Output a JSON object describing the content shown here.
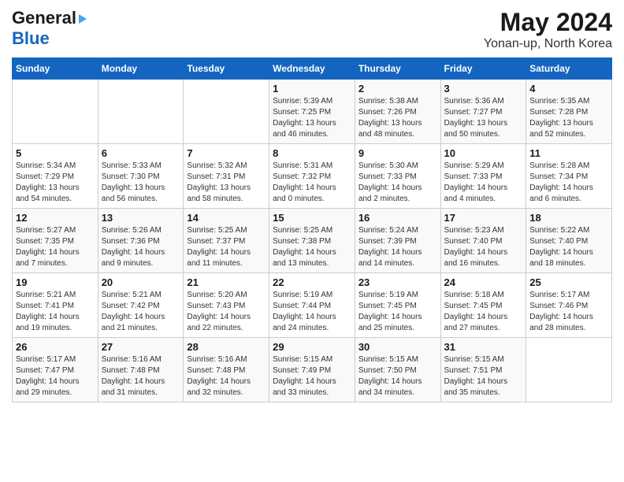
{
  "logo": {
    "line1": "General",
    "line2": "Blue"
  },
  "title": "May 2024",
  "subtitle": "Yonan-up, North Korea",
  "days_of_week": [
    "Sunday",
    "Monday",
    "Tuesday",
    "Wednesday",
    "Thursday",
    "Friday",
    "Saturday"
  ],
  "weeks": [
    [
      {
        "day": "",
        "info": ""
      },
      {
        "day": "",
        "info": ""
      },
      {
        "day": "",
        "info": ""
      },
      {
        "day": "1",
        "sunrise": "5:39 AM",
        "sunset": "7:25 PM",
        "daylight": "13 hours and 46 minutes."
      },
      {
        "day": "2",
        "sunrise": "5:38 AM",
        "sunset": "7:26 PM",
        "daylight": "13 hours and 48 minutes."
      },
      {
        "day": "3",
        "sunrise": "5:36 AM",
        "sunset": "7:27 PM",
        "daylight": "13 hours and 50 minutes."
      },
      {
        "day": "4",
        "sunrise": "5:35 AM",
        "sunset": "7:28 PM",
        "daylight": "13 hours and 52 minutes."
      }
    ],
    [
      {
        "day": "5",
        "sunrise": "5:34 AM",
        "sunset": "7:29 PM",
        "daylight": "13 hours and 54 minutes."
      },
      {
        "day": "6",
        "sunrise": "5:33 AM",
        "sunset": "7:30 PM",
        "daylight": "13 hours and 56 minutes."
      },
      {
        "day": "7",
        "sunrise": "5:32 AM",
        "sunset": "7:31 PM",
        "daylight": "13 hours and 58 minutes."
      },
      {
        "day": "8",
        "sunrise": "5:31 AM",
        "sunset": "7:32 PM",
        "daylight": "14 hours and 0 minutes."
      },
      {
        "day": "9",
        "sunrise": "5:30 AM",
        "sunset": "7:33 PM",
        "daylight": "14 hours and 2 minutes."
      },
      {
        "day": "10",
        "sunrise": "5:29 AM",
        "sunset": "7:33 PM",
        "daylight": "14 hours and 4 minutes."
      },
      {
        "day": "11",
        "sunrise": "5:28 AM",
        "sunset": "7:34 PM",
        "daylight": "14 hours and 6 minutes."
      }
    ],
    [
      {
        "day": "12",
        "sunrise": "5:27 AM",
        "sunset": "7:35 PM",
        "daylight": "14 hours and 7 minutes."
      },
      {
        "day": "13",
        "sunrise": "5:26 AM",
        "sunset": "7:36 PM",
        "daylight": "14 hours and 9 minutes."
      },
      {
        "day": "14",
        "sunrise": "5:25 AM",
        "sunset": "7:37 PM",
        "daylight": "14 hours and 11 minutes."
      },
      {
        "day": "15",
        "sunrise": "5:25 AM",
        "sunset": "7:38 PM",
        "daylight": "14 hours and 13 minutes."
      },
      {
        "day": "16",
        "sunrise": "5:24 AM",
        "sunset": "7:39 PM",
        "daylight": "14 hours and 14 minutes."
      },
      {
        "day": "17",
        "sunrise": "5:23 AM",
        "sunset": "7:40 PM",
        "daylight": "14 hours and 16 minutes."
      },
      {
        "day": "18",
        "sunrise": "5:22 AM",
        "sunset": "7:40 PM",
        "daylight": "14 hours and 18 minutes."
      }
    ],
    [
      {
        "day": "19",
        "sunrise": "5:21 AM",
        "sunset": "7:41 PM",
        "daylight": "14 hours and 19 minutes."
      },
      {
        "day": "20",
        "sunrise": "5:21 AM",
        "sunset": "7:42 PM",
        "daylight": "14 hours and 21 minutes."
      },
      {
        "day": "21",
        "sunrise": "5:20 AM",
        "sunset": "7:43 PM",
        "daylight": "14 hours and 22 minutes."
      },
      {
        "day": "22",
        "sunrise": "5:19 AM",
        "sunset": "7:44 PM",
        "daylight": "14 hours and 24 minutes."
      },
      {
        "day": "23",
        "sunrise": "5:19 AM",
        "sunset": "7:45 PM",
        "daylight": "14 hours and 25 minutes."
      },
      {
        "day": "24",
        "sunrise": "5:18 AM",
        "sunset": "7:45 PM",
        "daylight": "14 hours and 27 minutes."
      },
      {
        "day": "25",
        "sunrise": "5:17 AM",
        "sunset": "7:46 PM",
        "daylight": "14 hours and 28 minutes."
      }
    ],
    [
      {
        "day": "26",
        "sunrise": "5:17 AM",
        "sunset": "7:47 PM",
        "daylight": "14 hours and 29 minutes."
      },
      {
        "day": "27",
        "sunrise": "5:16 AM",
        "sunset": "7:48 PM",
        "daylight": "14 hours and 31 minutes."
      },
      {
        "day": "28",
        "sunrise": "5:16 AM",
        "sunset": "7:48 PM",
        "daylight": "14 hours and 32 minutes."
      },
      {
        "day": "29",
        "sunrise": "5:15 AM",
        "sunset": "7:49 PM",
        "daylight": "14 hours and 33 minutes."
      },
      {
        "day": "30",
        "sunrise": "5:15 AM",
        "sunset": "7:50 PM",
        "daylight": "14 hours and 34 minutes."
      },
      {
        "day": "31",
        "sunrise": "5:15 AM",
        "sunset": "7:51 PM",
        "daylight": "14 hours and 35 minutes."
      },
      {
        "day": "",
        "info": ""
      }
    ]
  ]
}
